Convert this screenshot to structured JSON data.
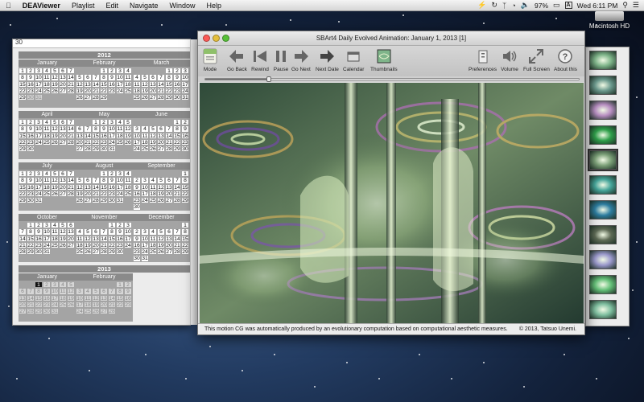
{
  "menubar": {
    "app_name": "DEAViewer",
    "items": [
      "Playlist",
      "Edit",
      "Navigate",
      "Window",
      "Help"
    ],
    "battery": "97%",
    "clock": "Wed 6:11 PM"
  },
  "desktop": {
    "disk_label": "Macintosh HD"
  },
  "calendar": {
    "prev_day": "30",
    "years": [
      "2012",
      "2013"
    ],
    "months_2012": [
      {
        "name": "January",
        "lead": 0,
        "days": 31,
        "dim_from": 30
      },
      {
        "name": "February",
        "lead": 3,
        "days": 29,
        "dim_from": 30
      },
      {
        "name": "March",
        "lead": 4,
        "days": 31,
        "dim_from": 32
      },
      {
        "name": "April",
        "lead": 0,
        "days": 30,
        "dim_from": 31
      },
      {
        "name": "May",
        "lead": 2,
        "days": 31,
        "dim_from": 32
      },
      {
        "name": "June",
        "lead": 5,
        "days": 30,
        "dim_from": 31
      },
      {
        "name": "July",
        "lead": 0,
        "days": 31,
        "dim_from": 32
      },
      {
        "name": "August",
        "lead": 3,
        "days": 31,
        "dim_from": 32
      },
      {
        "name": "September",
        "lead": 6,
        "days": 30,
        "dim_from": 31
      },
      {
        "name": "October",
        "lead": 1,
        "days": 31,
        "dim_from": 32
      },
      {
        "name": "November",
        "lead": 4,
        "days": 30,
        "dim_from": 31
      },
      {
        "name": "December",
        "lead": 6,
        "days": 31,
        "dim_from": 32
      }
    ],
    "months_2013": [
      {
        "name": "January",
        "lead": 2,
        "days": 31,
        "selected": 1,
        "dim_from": 2
      },
      {
        "name": "February",
        "lead": 5,
        "days": 28,
        "dim_from": 1
      }
    ]
  },
  "main_window": {
    "title": "SBArt4 Daily Evolved Animation: January 1, 2013 [1]",
    "toolbar": [
      {
        "label": "Mode",
        "icon": "mode-icon"
      },
      {
        "label": "Go Back",
        "icon": "go-back-icon"
      },
      {
        "label": "Rewind",
        "icon": "rewind-icon"
      },
      {
        "label": "Pause",
        "icon": "pause-icon"
      },
      {
        "label": "Go Next",
        "icon": "go-next-icon"
      },
      {
        "label": "Next Date",
        "icon": "next-date-icon"
      },
      {
        "label": "Calendar",
        "icon": "calendar-icon"
      },
      {
        "label": "Thumbnails",
        "icon": "thumbnails-icon"
      },
      {
        "label": "Preferences",
        "icon": "preferences-icon"
      },
      {
        "label": "Volume",
        "icon": "volume-icon"
      },
      {
        "label": "Full Screen",
        "icon": "full-screen-icon"
      },
      {
        "label": "About this",
        "icon": "about-icon"
      }
    ],
    "progress": 0.17,
    "caption": "This motion CG was automatically produced by an evolutionary computation based on computational aesthetic measures.",
    "copyright": "© 2013, Tatsuo Unemi."
  },
  "thumbnails": {
    "count": 11,
    "selected_index": 4,
    "colors": [
      "#7fb58a",
      "#6c9a8e",
      "#b78dc1",
      "#2f9f4a",
      "#7ca078",
      "#45a59a",
      "#2d7da0",
      "#5e6a55",
      "#9a98cc",
      "#64c078",
      "#7fbfa0"
    ]
  }
}
